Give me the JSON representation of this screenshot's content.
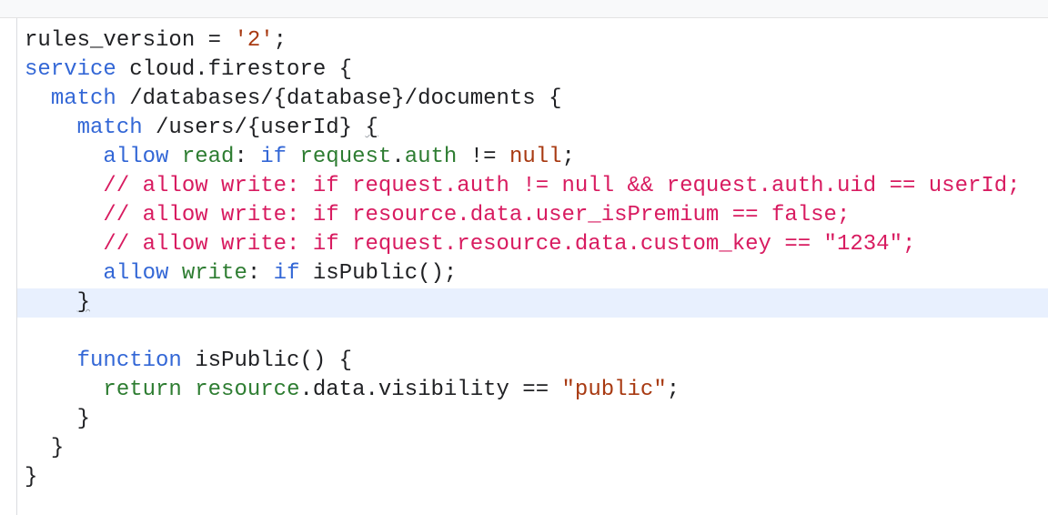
{
  "editor": {
    "lines": [
      {
        "indent": "",
        "tokens": [
          {
            "t": "rules_version = ",
            "c": "p"
          },
          {
            "t": "'2'",
            "c": "s"
          },
          {
            "t": ";",
            "c": "p"
          }
        ]
      },
      {
        "indent": "",
        "tokens": [
          {
            "t": "service",
            "c": "k"
          },
          {
            "t": " cloud.firestore {",
            "c": "p"
          }
        ]
      },
      {
        "indent": "  ",
        "tokens": [
          {
            "t": "match",
            "c": "k"
          },
          {
            "t": " /databases/{database}/documents {",
            "c": "p"
          }
        ]
      },
      {
        "indent": "    ",
        "tokens": [
          {
            "t": "match",
            "c": "k"
          },
          {
            "t": " /users/{userId} ",
            "c": "p"
          },
          {
            "t": "{",
            "c": "p",
            "u": true
          }
        ]
      },
      {
        "indent": "      ",
        "tokens": [
          {
            "t": "allow",
            "c": "k"
          },
          {
            "t": " ",
            "c": "p"
          },
          {
            "t": "read",
            "c": "m"
          },
          {
            "t": ": ",
            "c": "p"
          },
          {
            "t": "if",
            "c": "k"
          },
          {
            "t": " ",
            "c": "p"
          },
          {
            "t": "request",
            "c": "m"
          },
          {
            "t": ".",
            "c": "p"
          },
          {
            "t": "auth",
            "c": "m"
          },
          {
            "t": " != ",
            "c": "p"
          },
          {
            "t": "null",
            "c": "n"
          },
          {
            "t": ";",
            "c": "p"
          }
        ]
      },
      {
        "indent": "      ",
        "tokens": [
          {
            "t": "// allow write: if request.auth != null && request.auth.uid == userId;",
            "c": "c"
          }
        ]
      },
      {
        "indent": "      ",
        "tokens": [
          {
            "t": "// allow write: if resource.data.user_isPremium == false;",
            "c": "c"
          }
        ]
      },
      {
        "indent": "      ",
        "tokens": [
          {
            "t": "// allow write: if request.resource.data.custom_key == \"1234\";",
            "c": "c"
          }
        ]
      },
      {
        "indent": "      ",
        "tokens": [
          {
            "t": "allow",
            "c": "k"
          },
          {
            "t": " ",
            "c": "p"
          },
          {
            "t": "write",
            "c": "m"
          },
          {
            "t": ": ",
            "c": "p"
          },
          {
            "t": "if",
            "c": "k"
          },
          {
            "t": " isPublic();",
            "c": "p"
          }
        ]
      },
      {
        "indent": "    ",
        "active": true,
        "tokens": [
          {
            "t": "}",
            "c": "p",
            "u": true
          }
        ]
      },
      {
        "indent": "",
        "tokens": []
      },
      {
        "indent": "    ",
        "tokens": [
          {
            "t": "function",
            "c": "k"
          },
          {
            "t": " isPublic() {",
            "c": "p"
          }
        ]
      },
      {
        "indent": "      ",
        "tokens": [
          {
            "t": "return",
            "c": "m"
          },
          {
            "t": " ",
            "c": "p"
          },
          {
            "t": "resource",
            "c": "m"
          },
          {
            "t": ".data.visibility == ",
            "c": "p"
          },
          {
            "t": "\"public\"",
            "c": "s"
          },
          {
            "t": ";",
            "c": "p"
          }
        ]
      },
      {
        "indent": "    ",
        "tokens": [
          {
            "t": "}",
            "c": "p"
          }
        ]
      },
      {
        "indent": "  ",
        "tokens": [
          {
            "t": "}",
            "c": "p"
          }
        ]
      },
      {
        "indent": "",
        "tokens": [
          {
            "t": "}",
            "c": "p"
          }
        ]
      }
    ]
  }
}
